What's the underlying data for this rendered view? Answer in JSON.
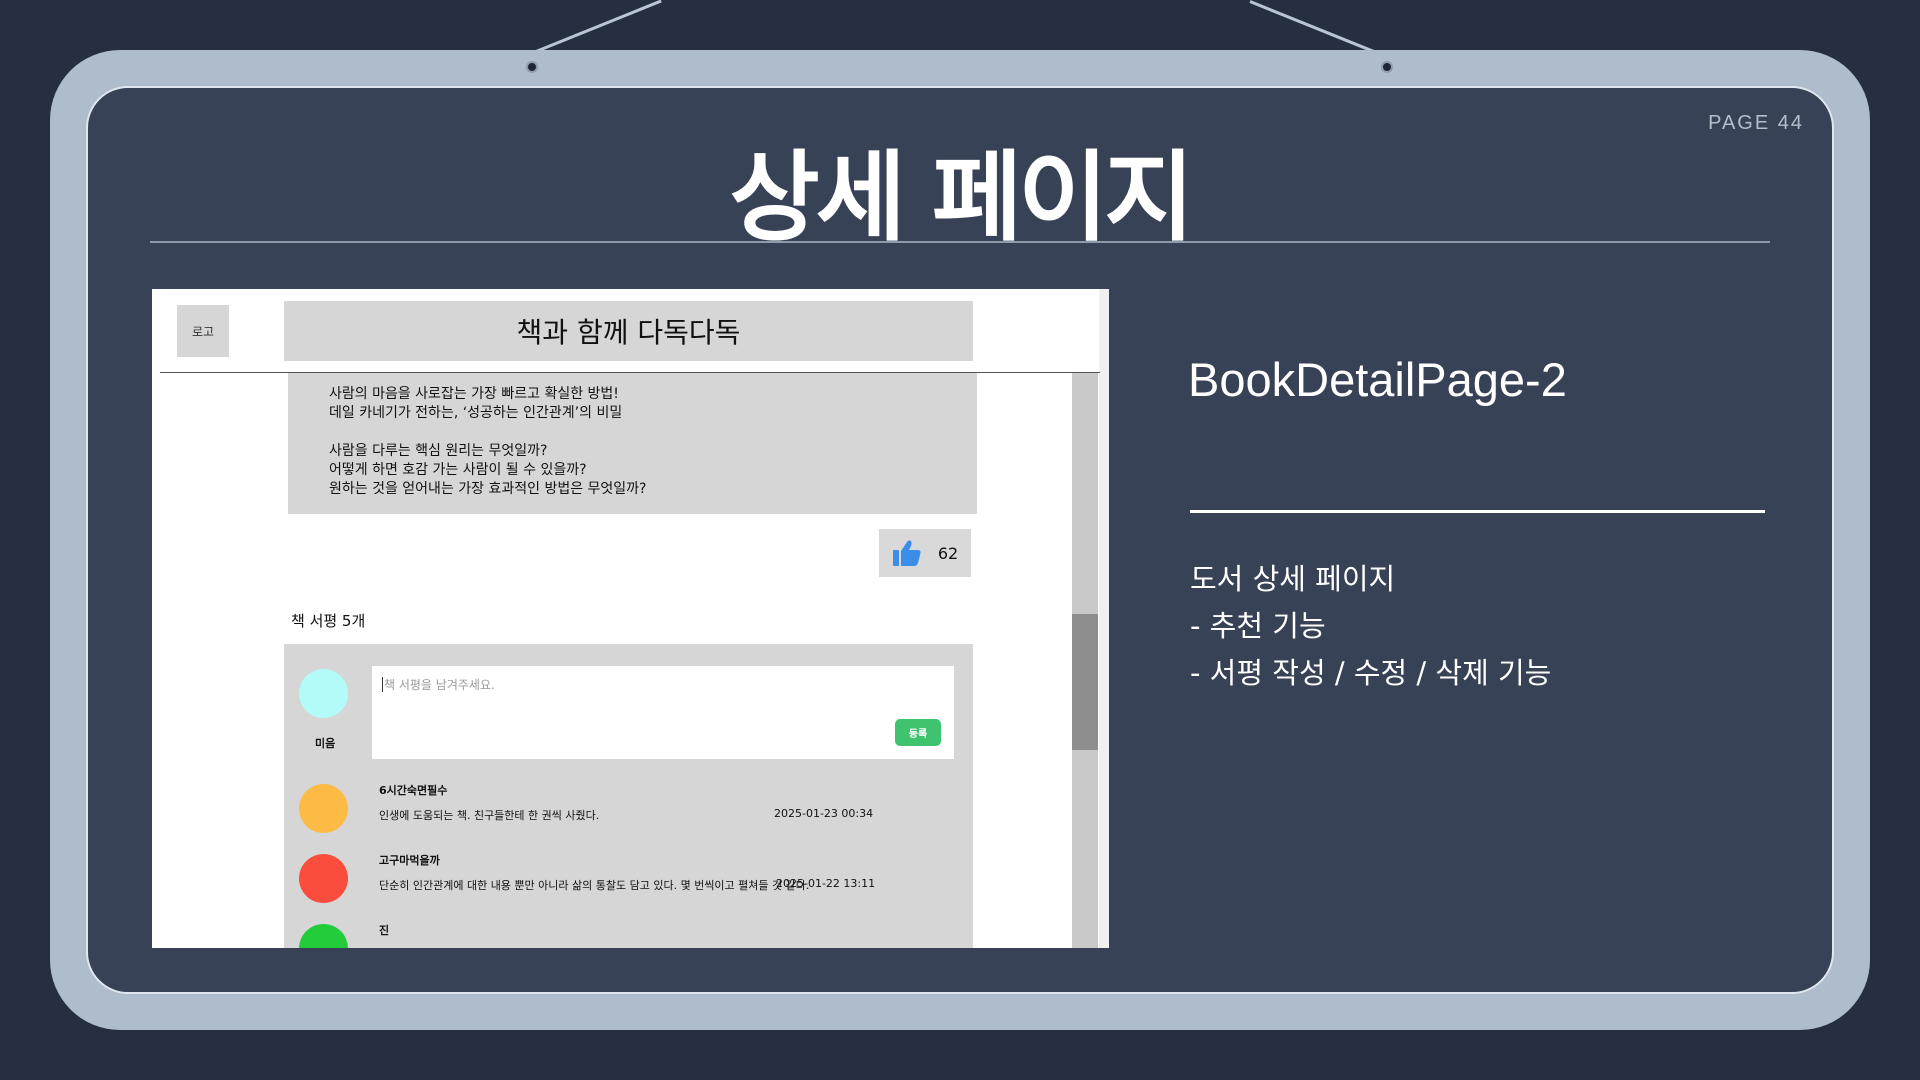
{
  "slide": {
    "page_number": "PAGE 44",
    "title": "상세 페이지"
  },
  "screenshot": {
    "logo": "로고",
    "site_title": "책과 함께 다독다독",
    "description": [
      "사람의 마음을 사로잡는 가장 빠르고 확실한 방법!",
      "데일 카네기가 전하는, ‘성공하는 인간관계’의 비밀",
      "사람을 다루는 핵심 원리는 무엇일까?",
      "어떻게 하면 호감 가는 사람이 될 수 있을까?",
      "원하는 것을 얻어내는 가장 효과적인 방법은 무엇일까?"
    ],
    "like_count": "62",
    "review_count": "책 서평 5개",
    "current_user": {
      "name": "미음",
      "avatar_color": "#b2fbf8"
    },
    "review_input": {
      "value": "",
      "placeholder": "책 서평을 남겨주세요."
    },
    "submit_label": "등록",
    "reviews": [
      {
        "name": "6시간숙면필수",
        "text": "인생에 도움되는 책. 친구들한테 한 권씩 사줬다.",
        "date": "2025-01-23 00:34",
        "avatar_color": "#fbbb45"
      },
      {
        "name": "고구마먹을까",
        "text": "단순히 인간관계에 대한 내용 뿐만 아니라 삶의 통찰도 담고 있다. 몇 번씩이고 펼쳐들 것 같다.",
        "date": "2025-01-22 13:11",
        "avatar_color": "#fb4d3d"
      },
      {
        "name": "진",
        "text": "",
        "date": "",
        "avatar_color": "#22cc3a"
      }
    ],
    "colors": {
      "like_icon": "#3a8de8",
      "submit_button": "#3fc36e"
    }
  },
  "side": {
    "page_name": "BookDetailPage-2",
    "features": [
      "도서 상세 페이지",
      "- 추천 기능",
      "- 서평 작성 / 수정 / 삭제 기능"
    ]
  }
}
